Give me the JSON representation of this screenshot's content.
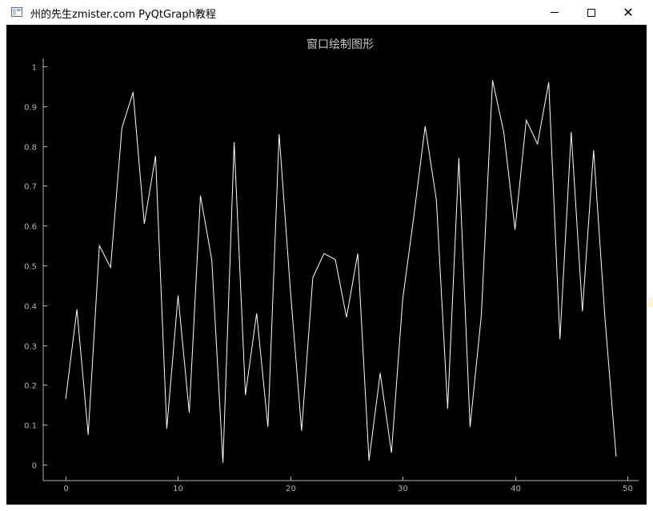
{
  "window": {
    "title": "州的先生zmister.com PyQtGraph教程",
    "icon": "app-window-icon",
    "controls": {
      "minimize": "minimize-icon",
      "maximize": "maximize-icon",
      "close": "close-icon"
    }
  },
  "colors": {
    "background": "#000000",
    "line": "#ffffff",
    "axis": "#b4b4b4",
    "title": "#c8c8c8"
  },
  "chart_data": {
    "type": "line",
    "title": "窗口绘制图形",
    "xlabel": "",
    "ylabel": "",
    "xlim": [
      -2,
      51
    ],
    "ylim": [
      -0.04,
      1.02
    ],
    "xticks": [
      0,
      10,
      20,
      30,
      40,
      50
    ],
    "yticks": [
      0,
      0.1,
      0.2,
      0.3,
      0.4,
      0.5,
      0.6,
      0.7,
      0.8,
      0.9,
      1
    ],
    "ytick_labels": [
      "0",
      "0.1",
      "0.2",
      "0.3",
      "0.4",
      "0.5",
      "0.6",
      "0.7",
      "0.8",
      "0.9",
      "1"
    ],
    "xtick_labels": [
      "0",
      "10",
      "20",
      "30",
      "40",
      "50"
    ],
    "grid": false,
    "series": [
      {
        "x": [
          0,
          1,
          2,
          3,
          4,
          5,
          6,
          7,
          8,
          9,
          10,
          11,
          12,
          13,
          14,
          15,
          16,
          17,
          18,
          19,
          20,
          21,
          22,
          23,
          24,
          25,
          26,
          27,
          28,
          29,
          30,
          31,
          32,
          33,
          34,
          35,
          36,
          37,
          38,
          39,
          40,
          41,
          42,
          43,
          44,
          45,
          46,
          47,
          48,
          49
        ],
        "values": [
          0.165,
          0.39,
          0.075,
          0.55,
          0.495,
          0.845,
          0.935,
          0.605,
          0.775,
          0.09,
          0.425,
          0.13,
          0.675,
          0.515,
          0.005,
          0.81,
          0.175,
          0.38,
          0.095,
          0.83,
          0.44,
          0.085,
          0.47,
          0.53,
          0.515,
          0.37,
          0.53,
          0.01,
          0.23,
          0.03,
          0.415,
          0.625,
          0.85,
          0.665,
          0.14,
          0.77,
          0.095,
          0.375,
          0.965,
          0.835,
          0.59,
          0.865,
          0.805,
          0.96,
          0.315,
          0.835,
          0.385,
          0.79,
          0.37,
          0.02
        ]
      }
    ]
  }
}
